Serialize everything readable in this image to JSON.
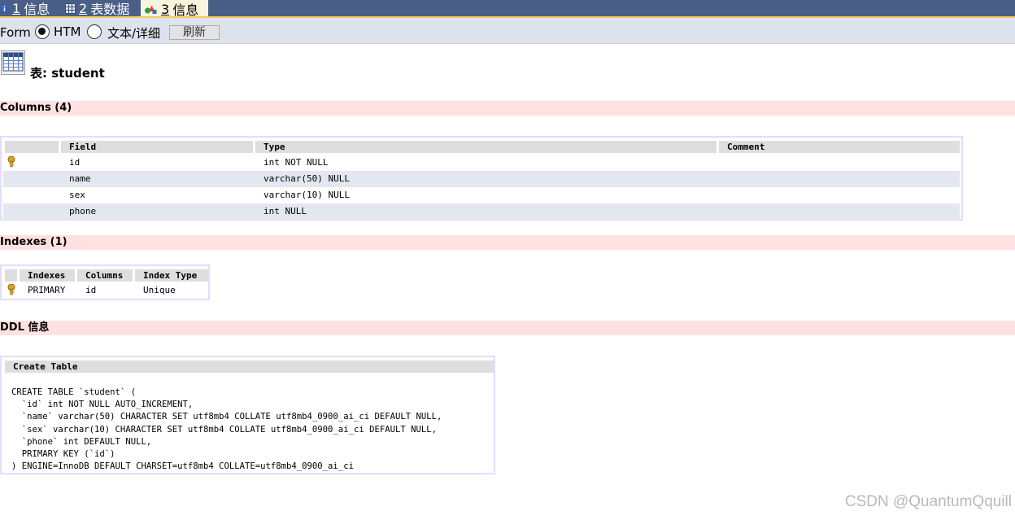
{
  "tabs": [
    {
      "num": "1",
      "label": "信息",
      "icon": "info-icon"
    },
    {
      "num": "2",
      "label": "表数据",
      "icon": "table-data-icon"
    },
    {
      "num": "3",
      "label": "信息",
      "icon": "info-shapes-icon",
      "active": true
    }
  ],
  "toolbar": {
    "format_label": "Format:",
    "option_html": "HTML",
    "option_text": "文本/详细",
    "selected": "HTML",
    "refresh_label": "刷新"
  },
  "page": {
    "title": "表: student"
  },
  "columns_section": {
    "title": "Columns (4)",
    "headers": [
      "Field",
      "Type",
      "Comment"
    ],
    "rows": [
      {
        "key": true,
        "field": "id",
        "type": "int NOT NULL",
        "comment": ""
      },
      {
        "key": false,
        "field": "name",
        "type": "varchar(50) NULL",
        "comment": ""
      },
      {
        "key": false,
        "field": "sex",
        "type": "varchar(10) NULL",
        "comment": ""
      },
      {
        "key": false,
        "field": "phone",
        "type": "int NULL",
        "comment": ""
      }
    ]
  },
  "indexes_section": {
    "title": "Indexes (1)",
    "headers": [
      "Indexes",
      "Columns",
      "Index Type"
    ],
    "rows": [
      {
        "key": true,
        "name": "PRIMARY",
        "columns": "id",
        "type": "Unique"
      }
    ]
  },
  "ddl_section": {
    "title": "DDL 信息",
    "header": "Create Table",
    "statement": "CREATE TABLE `student` (\n  `id` int NOT NULL AUTO_INCREMENT,\n  `name` varchar(50) CHARACTER SET utf8mb4 COLLATE utf8mb4_0900_ai_ci DEFAULT NULL,\n  `sex` varchar(10) CHARACTER SET utf8mb4 COLLATE utf8mb4_0900_ai_ci DEFAULT NULL,\n  `phone` int DEFAULT NULL,\n  PRIMARY KEY (`id`)\n) ENGINE=InnoDB DEFAULT CHARSET=utf8mb4 COLLATE=utf8mb4_0900_ai_ci"
  },
  "watermark": "CSDN @QuantumQquill",
  "colors": {
    "tabbar": "#4a5f86",
    "active_tab": "#f8f3dc",
    "toolbar": "#dde3ec",
    "section_header": "#ffe1e1",
    "table_border": "#e3dcff",
    "alt_row": "#e2e7f0",
    "key": "#e0a020"
  }
}
